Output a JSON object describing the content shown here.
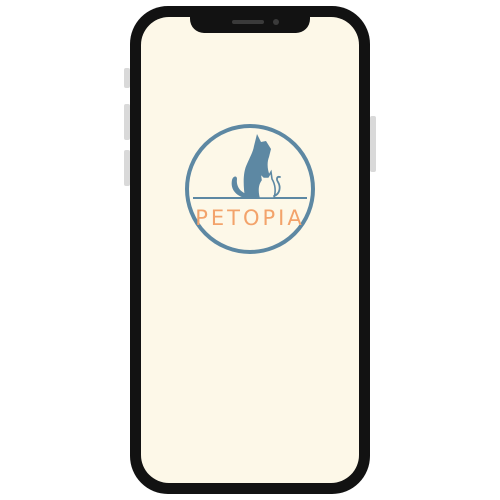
{
  "app": {
    "name": "PETOPIA"
  },
  "colors": {
    "screen_background": "#fdf8e8",
    "logo_blue": "#5d88a3",
    "brand_orange": "#f3a36b",
    "phone_frame": "#121212"
  },
  "icons": {
    "logo": "dog-and-cat-silhouette-icon"
  }
}
